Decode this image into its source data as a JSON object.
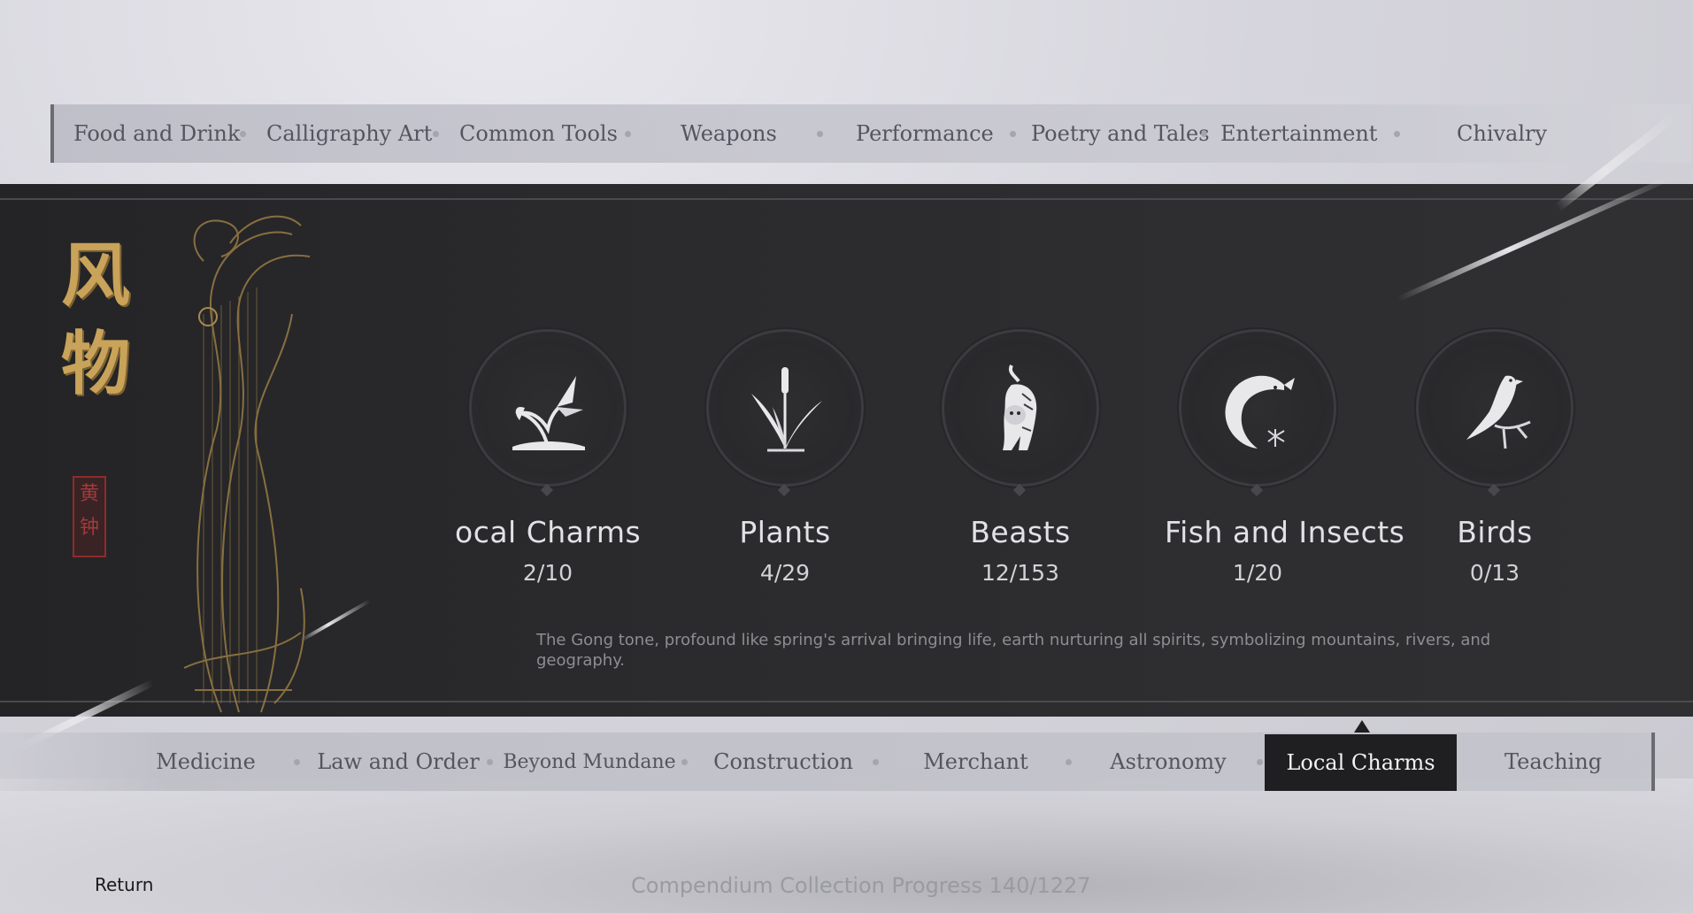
{
  "top_tabs": [
    "Food and Drink",
    "Calligraphy Art",
    "Common Tools",
    "Weapons",
    "Performance",
    "Poetry and Tales",
    "Entertainment",
    "Chivalry"
  ],
  "title_calligraphy": [
    "风",
    "物"
  ],
  "seal_text": [
    "黄",
    "钟"
  ],
  "categories": [
    {
      "name": "ocal Charms",
      "count": "2/10",
      "icon": "butterfly-flower-icon"
    },
    {
      "name": "Plants",
      "count": "4/29",
      "icon": "reed-plant-icon"
    },
    {
      "name": "Beasts",
      "count": "12/153",
      "icon": "tiger-icon"
    },
    {
      "name": "Fish and Insects",
      "count": "1/20",
      "icon": "fish-dragonfly-icon"
    },
    {
      "name": "Birds",
      "count": "0/13",
      "icon": "bird-on-branch-icon"
    }
  ],
  "description": "The Gong tone, profound like spring's arrival bringing life, earth nurturing all spirits, symbolizing mountains, rivers, and geography.",
  "bottom_tabs": [
    "Medicine",
    "Law and Order",
    "Beyond Mundane",
    "Construction",
    "Merchant",
    "Astronomy",
    "Local Charms",
    "Teaching"
  ],
  "active_bottom_tab": "Local Charms",
  "footer": {
    "return_label": "Return",
    "progress_text": "Compendium Collection Progress 140/1227"
  },
  "colors": {
    "accent_gold": "#c9a35a",
    "panel_dark": "#2a2a2c",
    "seal_red": "#a33a3a"
  }
}
